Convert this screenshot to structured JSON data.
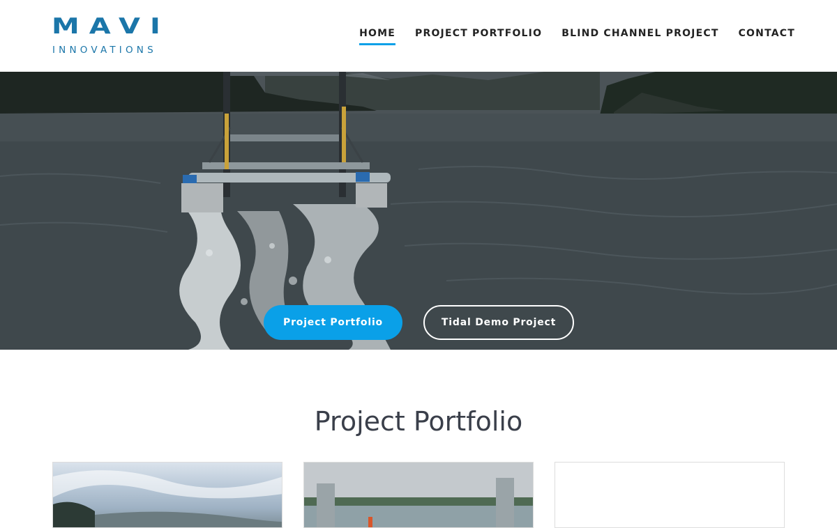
{
  "brand": {
    "name": "MAVI",
    "tagline": "INNOVATIONS",
    "color": "#1b76a9"
  },
  "nav": {
    "items": [
      {
        "label": "HOME",
        "active": true
      },
      {
        "label": "PROJECT PORTFOLIO",
        "active": false
      },
      {
        "label": "BLIND CHANNEL PROJECT",
        "active": false
      },
      {
        "label": "CONTACT",
        "active": false
      }
    ],
    "accent": "#0aa0e8"
  },
  "hero": {
    "image": "tidal turbine platform on water with wake",
    "buttons": {
      "primary": "Project Portfolio",
      "secondary": "Tidal Demo Project"
    }
  },
  "portfolio": {
    "title": "Project Portfolio",
    "cards": [
      {
        "image": "sky and hillside photo"
      },
      {
        "image": "platform on river photo"
      },
      {
        "image": "blank"
      }
    ]
  }
}
